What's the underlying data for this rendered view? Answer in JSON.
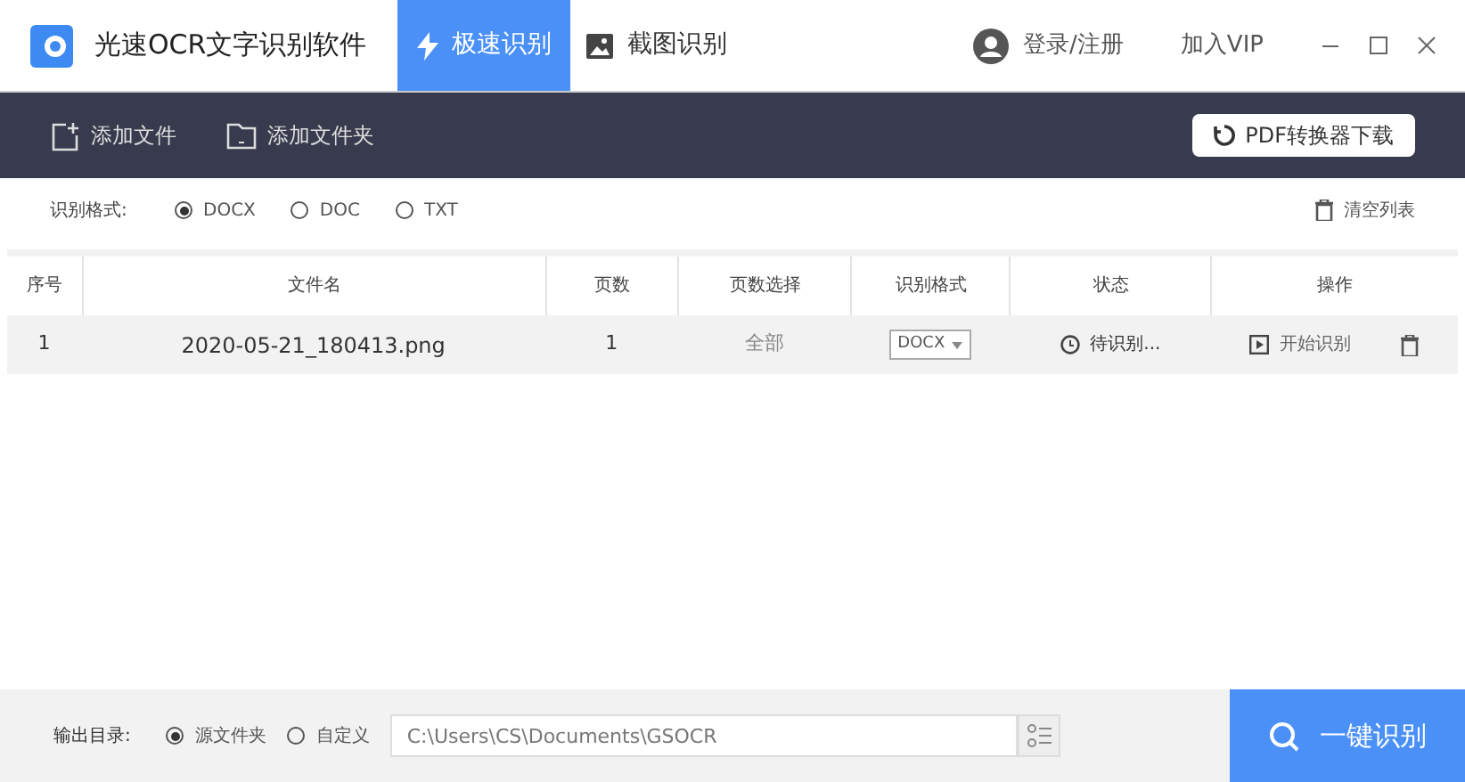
{
  "app": {
    "title": "光速OCR文字识别软件"
  },
  "tabs": [
    {
      "label": "极速识别",
      "selected": true,
      "kind": "bolt"
    },
    {
      "label": "截图识别",
      "selected": false,
      "kind": "image"
    }
  ],
  "account": {
    "login": "登录/注册",
    "vip": "加入VIP"
  },
  "toolbar": {
    "add_file": "添加文件",
    "add_folder": "添加文件夹",
    "pdf_button": "PDF转换器下载"
  },
  "format": {
    "label": "识别格式:",
    "options": [
      {
        "label": "DOCX",
        "selected": true
      },
      {
        "label": "DOC",
        "selected": false
      },
      {
        "label": "TXT",
        "selected": false
      }
    ],
    "clear": "清空列表"
  },
  "table": {
    "columns": [
      "序号",
      "文件名",
      "页数",
      "页数选择",
      "识别格式",
      "状态",
      "操作"
    ],
    "rows": [
      {
        "index": "1",
        "file": "2020-05-21_180413.png",
        "pages": "1",
        "page_select": "全部",
        "format": "DOCX",
        "status": "待识别...",
        "action": "开始识别"
      }
    ]
  },
  "output": {
    "label": "输出目录:",
    "options": [
      {
        "label": "源文件夹",
        "selected": true
      },
      {
        "label": "自定义",
        "selected": false
      }
    ],
    "path": "C:\\Users\\CS\\Documents\\GSOCR"
  },
  "start_button": "一键识别"
}
